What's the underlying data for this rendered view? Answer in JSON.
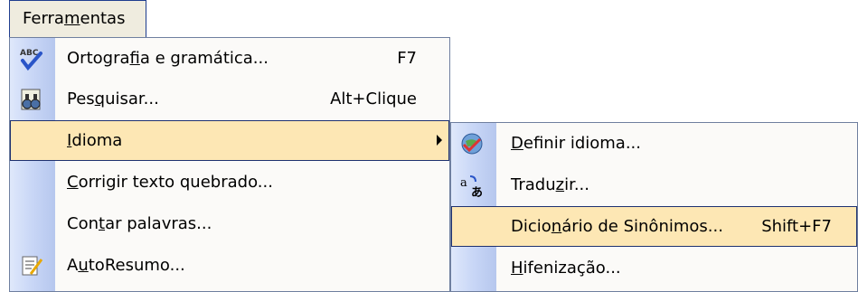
{
  "menu": {
    "title": "Ferramentas"
  },
  "main_items": [
    {
      "label": "Ortografia e gramática...",
      "shortcut": "F7",
      "icon": "spelling-abc-icon"
    },
    {
      "label": "Pesquisar...",
      "shortcut": "Alt+Clique",
      "icon": "research-binoculars-icon"
    },
    {
      "label": "Idioma",
      "shortcut": "",
      "icon": "",
      "highlighted": true,
      "has_submenu": true
    },
    {
      "label": "Corrigir texto quebrado...",
      "shortcut": "",
      "icon": ""
    },
    {
      "label": "Contar palavras...",
      "shortcut": "",
      "icon": ""
    },
    {
      "label": "AutoResumo...",
      "shortcut": "",
      "icon": "autosummarize-icon"
    }
  ],
  "submenu_items": [
    {
      "label": "Definir idioma...",
      "shortcut": "",
      "icon": "globe-check-icon"
    },
    {
      "label": "Traduzir...",
      "shortcut": "",
      "icon": "translate-icon"
    },
    {
      "label": "Dicionário de Sinônimos...",
      "shortcut": "Shift+F7",
      "icon": "",
      "highlighted": true
    },
    {
      "label": "Hifenização...",
      "shortcut": "",
      "icon": ""
    }
  ],
  "colors": {
    "highlight_bg": "#fde7b4",
    "highlight_border": "#1e3170",
    "menu_border": "#6f7f9f",
    "icon_strip": "#c8d6f6"
  }
}
